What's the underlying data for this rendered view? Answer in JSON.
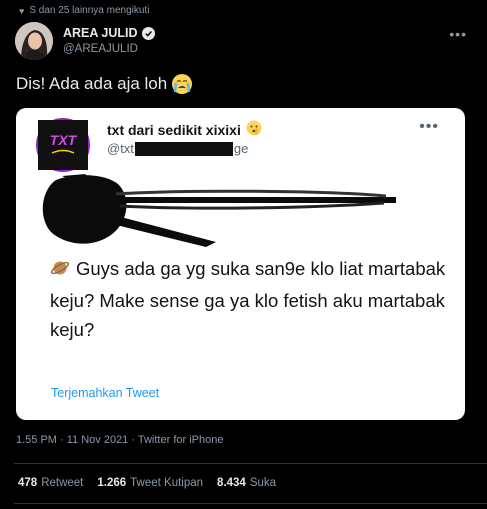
{
  "social_context": {
    "text": "S dan 25 lainnya mengikuti"
  },
  "author": {
    "name": "AREA JULID",
    "handle": "@AREAJULID"
  },
  "tweet": {
    "text": "Dis! Ada ada aja loh"
  },
  "quoted": {
    "name": "txt dari sedikit xixixi",
    "handle_start": "@txt",
    "handle_end": "ge",
    "body": "Guys ada ga yg suka san9e klo liat martabak keju? Make sense ga ya klo fetish aku martabak keju?",
    "translate_label": "Terjemahkan Tweet"
  },
  "meta": {
    "time": "1.55 PM · 11 Nov 2021 · Twitter for iPhone"
  },
  "stats": {
    "retweets": "478",
    "retweets_label": "Retweet",
    "quotes": "1.266",
    "quotes_label": "Tweet Kutipan",
    "likes": "8.434",
    "likes_label": "Suka"
  },
  "colors": {
    "background": "#000000",
    "text": "#e7e9ea",
    "muted": "#8b98a5",
    "link": "#1d9bf0",
    "card": "#ffffff"
  },
  "icons": [
    "heart-icon",
    "verified-icon",
    "more-icon",
    "crying-emoji-icon",
    "shushing-emoji-icon",
    "planet-emoji-icon"
  ]
}
